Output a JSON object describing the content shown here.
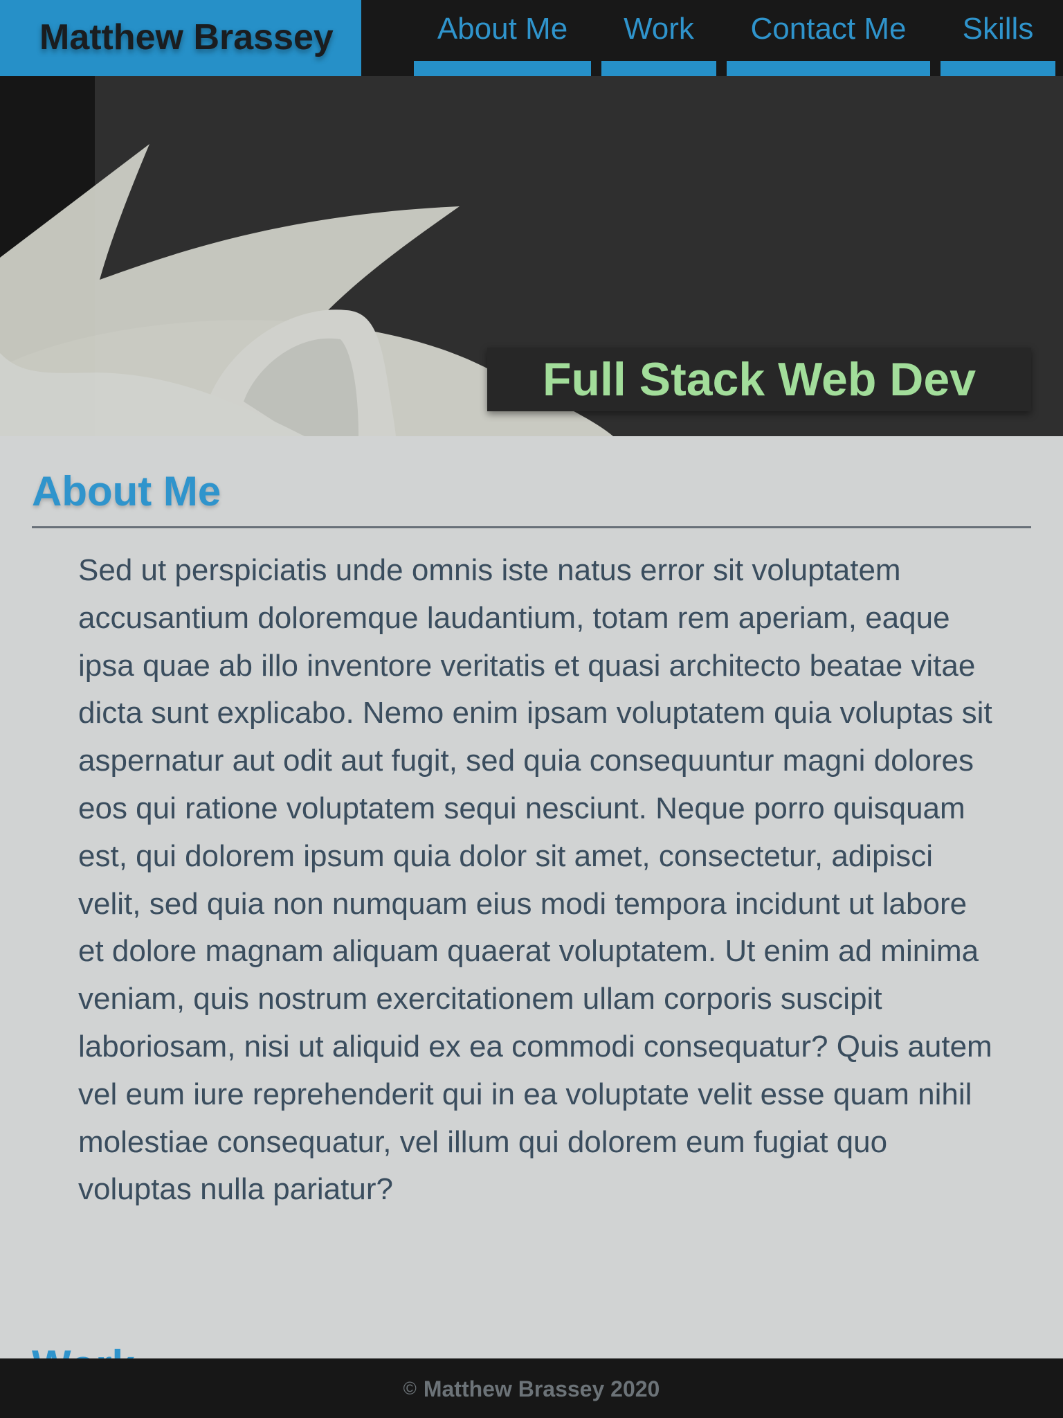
{
  "header": {
    "brand_name": "Matthew Brassey",
    "nav": [
      {
        "label": "About Me"
      },
      {
        "label": "Work"
      },
      {
        "label": "Contact Me"
      },
      {
        "label": "Skills"
      }
    ]
  },
  "hero": {
    "tagline": "Full Stack Web Dev"
  },
  "about": {
    "title": "About Me",
    "body": "Sed ut perspiciatis unde omnis iste natus error sit voluptatem accusantium doloremque laudantium, totam rem aperiam, eaque ipsa quae ab illo inventore veritatis et quasi architecto beatae vitae dicta sunt explicabo. Nemo enim ipsam voluptatem quia voluptas sit aspernatur aut odit aut fugit, sed quia consequuntur magni dolores eos qui ratione voluptatem sequi nesciunt. Neque porro quisquam est, qui dolorem ipsum quia dolor sit amet, consectetur, adipisci velit, sed quia non numquam eius modi tempora incidunt ut labore et dolore magnam aliquam quaerat voluptatem. Ut enim ad minima veniam, quis nostrum exercitationem ullam corporis suscipit laboriosam, nisi ut aliquid ex ea commodi consequatur? Quis autem vel eum iure reprehenderit qui in ea voluptate velit esse quam nihil molestiae consequatur, vel illum qui dolorem eum fugiat quo voluptas nulla pariatur?"
  },
  "work": {
    "title": "Work"
  },
  "footer": {
    "icon": "copyright-icon",
    "text": "Matthew Brassey 2020"
  },
  "colors": {
    "accent": "#2690c8",
    "header_bg": "#181818",
    "page_bg": "#d1d3d3",
    "tagline": "#a2dd9a",
    "body_text": "#3a4d5e"
  }
}
